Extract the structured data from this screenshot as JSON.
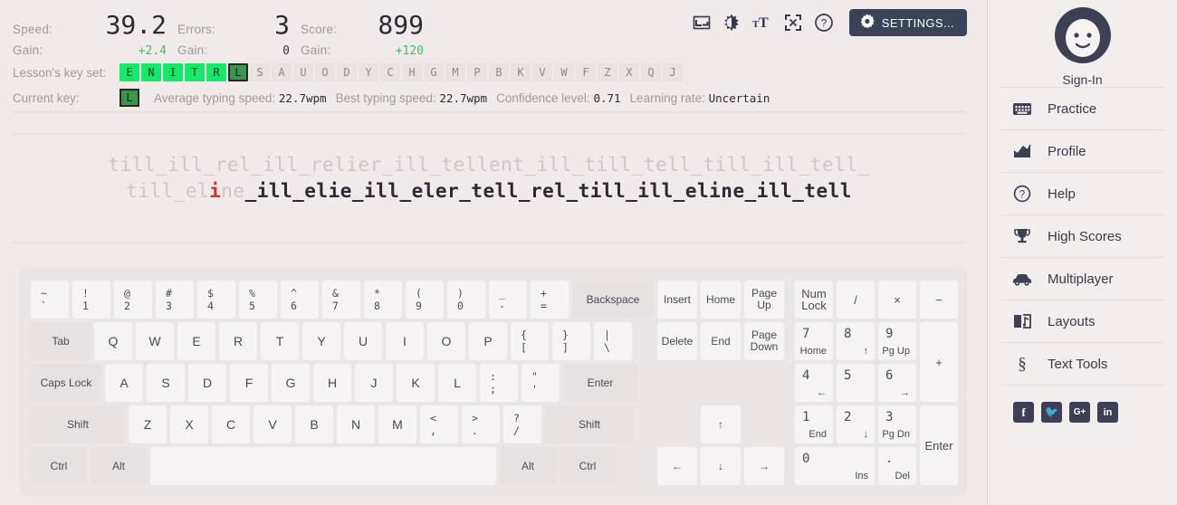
{
  "stats": {
    "speed_label": "Speed:",
    "speed_value": "39.2",
    "speed_gain_label": "Gain:",
    "speed_gain": "+2.4",
    "errors_label": "Errors:",
    "errors_value": "3",
    "errors_gain_label": "Gain:",
    "errors_gain": "0",
    "score_label": "Score:",
    "score_value": "899",
    "score_gain_label": "Gain:",
    "score_gain": "+120"
  },
  "keyset": {
    "label": "Lesson's key set:",
    "keys": [
      {
        "ch": "E",
        "state": "learned"
      },
      {
        "ch": "N",
        "state": "learned"
      },
      {
        "ch": "I",
        "state": "learned"
      },
      {
        "ch": "T",
        "state": "learned"
      },
      {
        "ch": "R",
        "state": "learned"
      },
      {
        "ch": "L",
        "state": "current"
      },
      {
        "ch": "S",
        "state": "locked"
      },
      {
        "ch": "A",
        "state": "locked"
      },
      {
        "ch": "U",
        "state": "locked"
      },
      {
        "ch": "O",
        "state": "locked"
      },
      {
        "ch": "D",
        "state": "locked"
      },
      {
        "ch": "Y",
        "state": "locked"
      },
      {
        "ch": "C",
        "state": "locked"
      },
      {
        "ch": "H",
        "state": "locked"
      },
      {
        "ch": "G",
        "state": "locked"
      },
      {
        "ch": "M",
        "state": "locked"
      },
      {
        "ch": "P",
        "state": "locked"
      },
      {
        "ch": "B",
        "state": "locked"
      },
      {
        "ch": "K",
        "state": "locked"
      },
      {
        "ch": "V",
        "state": "locked"
      },
      {
        "ch": "W",
        "state": "locked"
      },
      {
        "ch": "F",
        "state": "locked"
      },
      {
        "ch": "Z",
        "state": "locked"
      },
      {
        "ch": "X",
        "state": "locked"
      },
      {
        "ch": "Q",
        "state": "locked"
      },
      {
        "ch": "J",
        "state": "locked"
      }
    ]
  },
  "currentkey": {
    "label": "Current key:",
    "key": "L",
    "avg_label": "Average typing speed:",
    "avg_value": "22.7wpm",
    "best_label": "Best typing speed:",
    "best_value": "22.7wpm",
    "conf_label": "Confidence level:",
    "conf_value": "0.71",
    "rate_label": "Learning rate:",
    "rate_value": "Uncertain"
  },
  "toolbar": {
    "icons": [
      "crop-icon",
      "contrast-icon",
      "text-size-icon",
      "fullscreen-icon",
      "help-icon"
    ],
    "settings_label": "SETTINGS...",
    "settings_bg": "#3a4357"
  },
  "typing": {
    "line1_done": "till_ill_rel_ill_relier_ill_tellent_ill_till_tell_till_ill_tell_",
    "line2_done": "till_el",
    "line2_error": "i",
    "line2_cursor": "ne",
    "line2_todo": "_ill_elie_ill_eler_tell_rel_till_ill_eline_ill_tell",
    "error_color": "#d5322f"
  },
  "keyboard": {
    "row1": [
      {
        "top": "~",
        "bottom": "`"
      },
      {
        "top": "!",
        "bottom": "1"
      },
      {
        "top": "@",
        "bottom": "2"
      },
      {
        "top": "#",
        "bottom": "3"
      },
      {
        "top": "$",
        "bottom": "4"
      },
      {
        "top": "%",
        "bottom": "5"
      },
      {
        "top": "^",
        "bottom": "6"
      },
      {
        "top": "&",
        "bottom": "7"
      },
      {
        "top": "*",
        "bottom": "8"
      },
      {
        "top": "(",
        "bottom": "9"
      },
      {
        "top": ")",
        "bottom": "0"
      },
      {
        "top": "_",
        "bottom": "-"
      },
      {
        "top": "+",
        "bottom": "="
      }
    ],
    "row1_last": "Backspace",
    "row2_first": "Tab",
    "row2": [
      "Q",
      "W",
      "E",
      "R",
      "T",
      "Y",
      "U",
      "I",
      "O",
      "P"
    ],
    "row2_dual": [
      {
        "top": "{",
        "bottom": "["
      },
      {
        "top": "}",
        "bottom": "]"
      },
      {
        "top": "|",
        "bottom": "\\"
      }
    ],
    "row3_first": "Caps Lock",
    "row3": [
      "A",
      "S",
      "D",
      "F",
      "G",
      "H",
      "J",
      "K",
      "L"
    ],
    "row3_dual": [
      {
        "top": ":",
        "bottom": ";"
      },
      {
        "top": "\"",
        "bottom": "'"
      }
    ],
    "row3_last": "Enter",
    "row4_first": "Shift",
    "row4": [
      "Z",
      "X",
      "C",
      "V",
      "B",
      "N",
      "M"
    ],
    "row4_dual": [
      {
        "top": "<",
        "bottom": ","
      },
      {
        "top": ">",
        "bottom": "."
      },
      {
        "top": "?",
        "bottom": "/"
      }
    ],
    "row4_last": "Shift",
    "row5": [
      "Ctrl",
      "Alt",
      "",
      "Alt",
      "Ctrl"
    ],
    "nav": {
      "row1": [
        "Insert",
        "Home",
        "Page Up"
      ],
      "row2": [
        "Delete",
        "End",
        "Page Down"
      ],
      "arrow_up": "↑",
      "arrow_left": "←",
      "arrow_down": "↓",
      "arrow_right": "→"
    },
    "numpad": {
      "numlock": "Num Lock",
      "divide": "/",
      "multiply": "×",
      "minus": "−",
      "plus": "+",
      "enter": "Enter",
      "k7": {
        "n": "7",
        "s": "Home"
      },
      "k8": {
        "n": "8",
        "s": "↑"
      },
      "k9": {
        "n": "9",
        "s": "Pg Up"
      },
      "k4": {
        "n": "4",
        "s": "←"
      },
      "k5": {
        "n": "5",
        "s": ""
      },
      "k6": {
        "n": "6",
        "s": "→"
      },
      "k1": {
        "n": "1",
        "s": "End"
      },
      "k2": {
        "n": "2",
        "s": "↓"
      },
      "k3": {
        "n": "3",
        "s": "Pg Dn"
      },
      "k0": {
        "n": "0",
        "s": "Ins"
      },
      "kdot": {
        "n": ".",
        "s": "Del"
      }
    }
  },
  "sidebar": {
    "account_label": "Sign-In",
    "items": [
      {
        "label": "Practice",
        "icon": "keyboard-icon"
      },
      {
        "label": "Profile",
        "icon": "chart-icon"
      },
      {
        "label": "Help",
        "icon": "help-icon"
      },
      {
        "label": "High Scores",
        "icon": "trophy-icon"
      },
      {
        "label": "Multiplayer",
        "icon": "car-icon"
      },
      {
        "label": "Layouts",
        "icon": "layouts-icon"
      },
      {
        "label": "Text Tools",
        "icon": "section-icon"
      }
    ],
    "social": [
      {
        "name": "facebook-icon",
        "glyph": "f"
      },
      {
        "name": "twitter-icon",
        "glyph": "🐦"
      },
      {
        "name": "google-plus-icon",
        "glyph": "G+"
      },
      {
        "name": "linkedin-icon",
        "glyph": "in"
      }
    ]
  }
}
